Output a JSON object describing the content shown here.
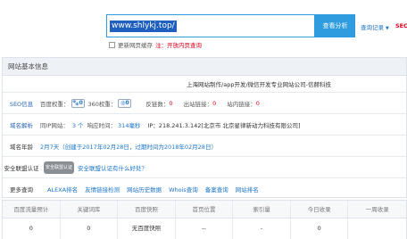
{
  "search": {
    "value": "www.shlykj.top/",
    "button": "查看分析",
    "query_record": "查询记录",
    "seo_cut": "SEO"
  },
  "update": {
    "label": "更新网页缓存",
    "note": "注：开放内页查询"
  },
  "panel": {
    "title": "网站基本信息",
    "site_title": "上海网站制作/app开发/微信开发专业网站公司-信赫科技"
  },
  "seo": {
    "label": "SEO信息",
    "baidu_weight_label": "百度权重：",
    "baidu_weight": "0",
    "w360_label": "360权重：",
    "w360": "0",
    "backlinks_label": "反链数：",
    "backlinks": "0",
    "outlinks_label": "出站链接：",
    "outlinks": "0",
    "inlinks_label": "站内链接：",
    "inlinks": "0"
  },
  "domain": {
    "label": "域名解析",
    "same_ip_label": "同IP网站：",
    "same_ip": "3 个",
    "response_label": "响应时间：",
    "response": "314毫秒",
    "ip_info": "IP：218.241.3.142[北京市 北京星律新动力科技有限公司]"
  },
  "age": {
    "label": "域名年龄",
    "value": "2月7天（创建于2017年02月28日，过期时间为2018年02月28日）"
  },
  "security": {
    "label": "安全联盟认证",
    "shield": "安全联盟认证",
    "link": "安全联盟认证有什么好处？"
  },
  "more": {
    "label": "更多查询",
    "links": [
      "ALEXA排名",
      "友情链接检测",
      "网站历史数据",
      "Whois查询",
      "备案查询",
      "网站排名"
    ]
  },
  "grid": {
    "headers": [
      "百度流量预计",
      "关键词库",
      "百度快照",
      "首页位置",
      "索引量",
      "今日收录",
      "一周收录"
    ],
    "values": [
      "0",
      "0",
      "无百度快照",
      "--",
      "-",
      "0",
      ""
    ]
  },
  "colors": {
    "accent": "#2e9cdf",
    "link": "#1a74c7",
    "warning": "#d9001b"
  }
}
